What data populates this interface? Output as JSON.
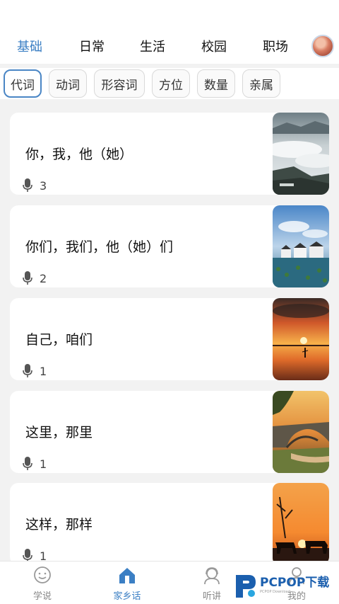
{
  "top_tabs": [
    "基础",
    "日常",
    "生活",
    "校园",
    "职场"
  ],
  "sub_tabs": [
    "代词",
    "动词",
    "形容词",
    "方位",
    "数量",
    "亲属"
  ],
  "cards": [
    {
      "title": "你，我，他（她）",
      "count": "3",
      "image": "misty-mountain-sea-of-clouds"
    },
    {
      "title": "你们，我们，他（她）们",
      "count": "2",
      "image": "white-village-lotus-pond"
    },
    {
      "title": "自己，咱们",
      "count": "1",
      "image": "sunset-over-lake-with-person"
    },
    {
      "title": "这里，那里",
      "count": "1",
      "image": "stone-arch-bridge-at-sunset"
    },
    {
      "title": "这样，那样",
      "count": "1",
      "image": "buffalo-silhouettes-at-sunset"
    }
  ],
  "bottom_nav": [
    {
      "label": "学说",
      "icon": "smiley-chat-icon"
    },
    {
      "label": "家乡话",
      "icon": "home-icon"
    },
    {
      "label": "听讲",
      "icon": "headset-person-icon"
    },
    {
      "label": "我的",
      "icon": "person-icon"
    }
  ],
  "watermark": {
    "text": "PCPOP下载",
    "sub": "PCPOP Download"
  },
  "colors": {
    "accent": "#3b7fc4",
    "background": "#f2f2f2",
    "card": "#ffffff"
  }
}
